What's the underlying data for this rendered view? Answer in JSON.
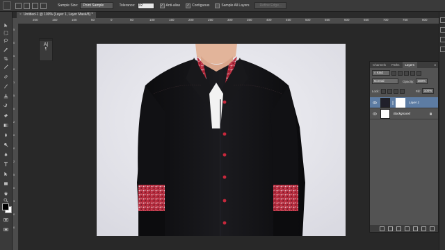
{
  "options_bar": {
    "sample_size_label": "Sample Size:",
    "sample_size_value": "Point Sample",
    "tolerance_label": "Tolerance:",
    "tolerance_value": "32",
    "antialias_label": "Anti-alias",
    "antialias_checked": true,
    "contiguous_label": "Contiguous",
    "contiguous_checked": true,
    "sample_all_layers_label": "Sample All Layers",
    "sample_all_layers_checked": false,
    "refine_edge_label": "Refine Edge..."
  },
  "document_tab": {
    "title": "Untitled-1 @ 100% (Layer 1, Layer Mask/8) *",
    "close_symbol": "×"
  },
  "ruler": {
    "top_marks": [
      "200",
      "150",
      "100",
      "50",
      "0",
      "50",
      "100",
      "150",
      "200",
      "250",
      "300",
      "350",
      "400",
      "450",
      "500",
      "550",
      "600",
      "650",
      "700",
      "750",
      "800",
      "850"
    ],
    "left_marks": [
      "5",
      "0",
      "5",
      "0",
      "1",
      "5",
      "0",
      "2",
      "0",
      "0",
      "2",
      "5",
      "0",
      "3",
      "0",
      "0"
    ]
  },
  "mini_panel": {
    "glyph1": "A|",
    "glyph2": "¶"
  },
  "layers_panel": {
    "tabs": [
      "Channels",
      "Paths",
      "Layers"
    ],
    "active_tab": "Layers",
    "filter_label": "Kind",
    "blend_mode": "Normal",
    "opacity_label": "Opacity:",
    "opacity_value": "100%",
    "lock_label": "Lock:",
    "fill_label": "Fill:",
    "fill_value": "100%",
    "layers": [
      {
        "name": "Layer 1",
        "selected": true,
        "has_mask": true
      },
      {
        "name": "Background",
        "selected": false,
        "locked": true
      }
    ],
    "footer_icons": [
      "link-icon",
      "fx-icon",
      "mask-icon",
      "adjustment-icon",
      "group-icon",
      "new-layer-icon",
      "trash-icon"
    ]
  },
  "colors": {
    "ui_dark": "#262626",
    "panel": "#535353",
    "selection": "#5d7ca3",
    "shirt": "#141416",
    "accent_red": "#c8283c"
  }
}
